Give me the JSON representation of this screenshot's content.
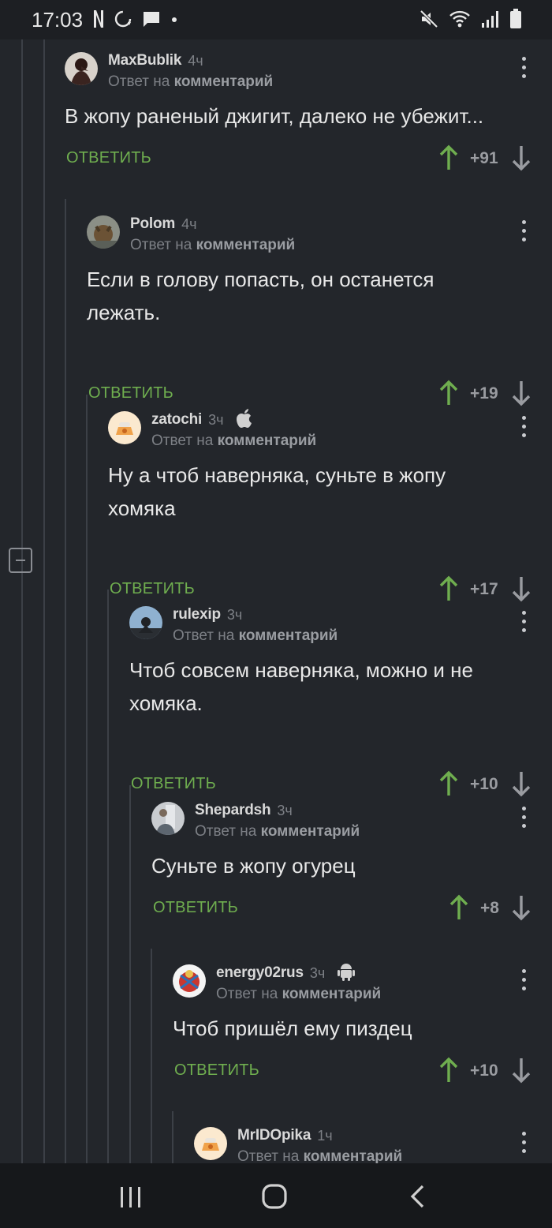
{
  "status_bar": {
    "time": "17:03",
    "left_icons": [
      "netflix-icon",
      "sync-icon",
      "message-icon",
      "dot-icon"
    ],
    "right_icons": [
      "mute-icon",
      "wifi-icon",
      "signal-icon",
      "battery-icon"
    ]
  },
  "labels": {
    "reply_to_prefix": "Ответ на",
    "reply_to_target": "комментарий",
    "reply_button": "ОТВЕТИТЬ"
  },
  "comments": [
    {
      "author": "MaxBublik",
      "time": "4ч",
      "badge": "",
      "text": "В жопу раненый джигит, далеко не убежит...",
      "rating": "+91"
    },
    {
      "author": "Polom",
      "time": "4ч",
      "badge": "",
      "text": "Если в голову попасть, он останется лежать.",
      "rating": "+19"
    },
    {
      "author": "zatochi",
      "time": "3ч",
      "badge": "apple-icon",
      "text": "Ну а чтоб наверняка, суньте в жопу хомяка",
      "rating": "+17"
    },
    {
      "author": "rulexip",
      "time": "3ч",
      "badge": "",
      "text": "Чтоб совсем наверняка, можно и не хомяка.",
      "rating": "+10"
    },
    {
      "author": "Shepardsh",
      "time": "3ч",
      "badge": "",
      "text": "Суньте в жопу огурец",
      "rating": "+8"
    },
    {
      "author": "energy02rus",
      "time": "3ч",
      "badge": "android-icon",
      "text": "Чтоб пришёл ему пиздец",
      "rating": "+10"
    },
    {
      "author": "MrIDOpika",
      "time": "1ч",
      "badge": "",
      "text": "",
      "rating": ""
    }
  ],
  "colors": {
    "background": "#23262b",
    "upvote": "#6fae4f",
    "reply": "#6fae4f"
  }
}
